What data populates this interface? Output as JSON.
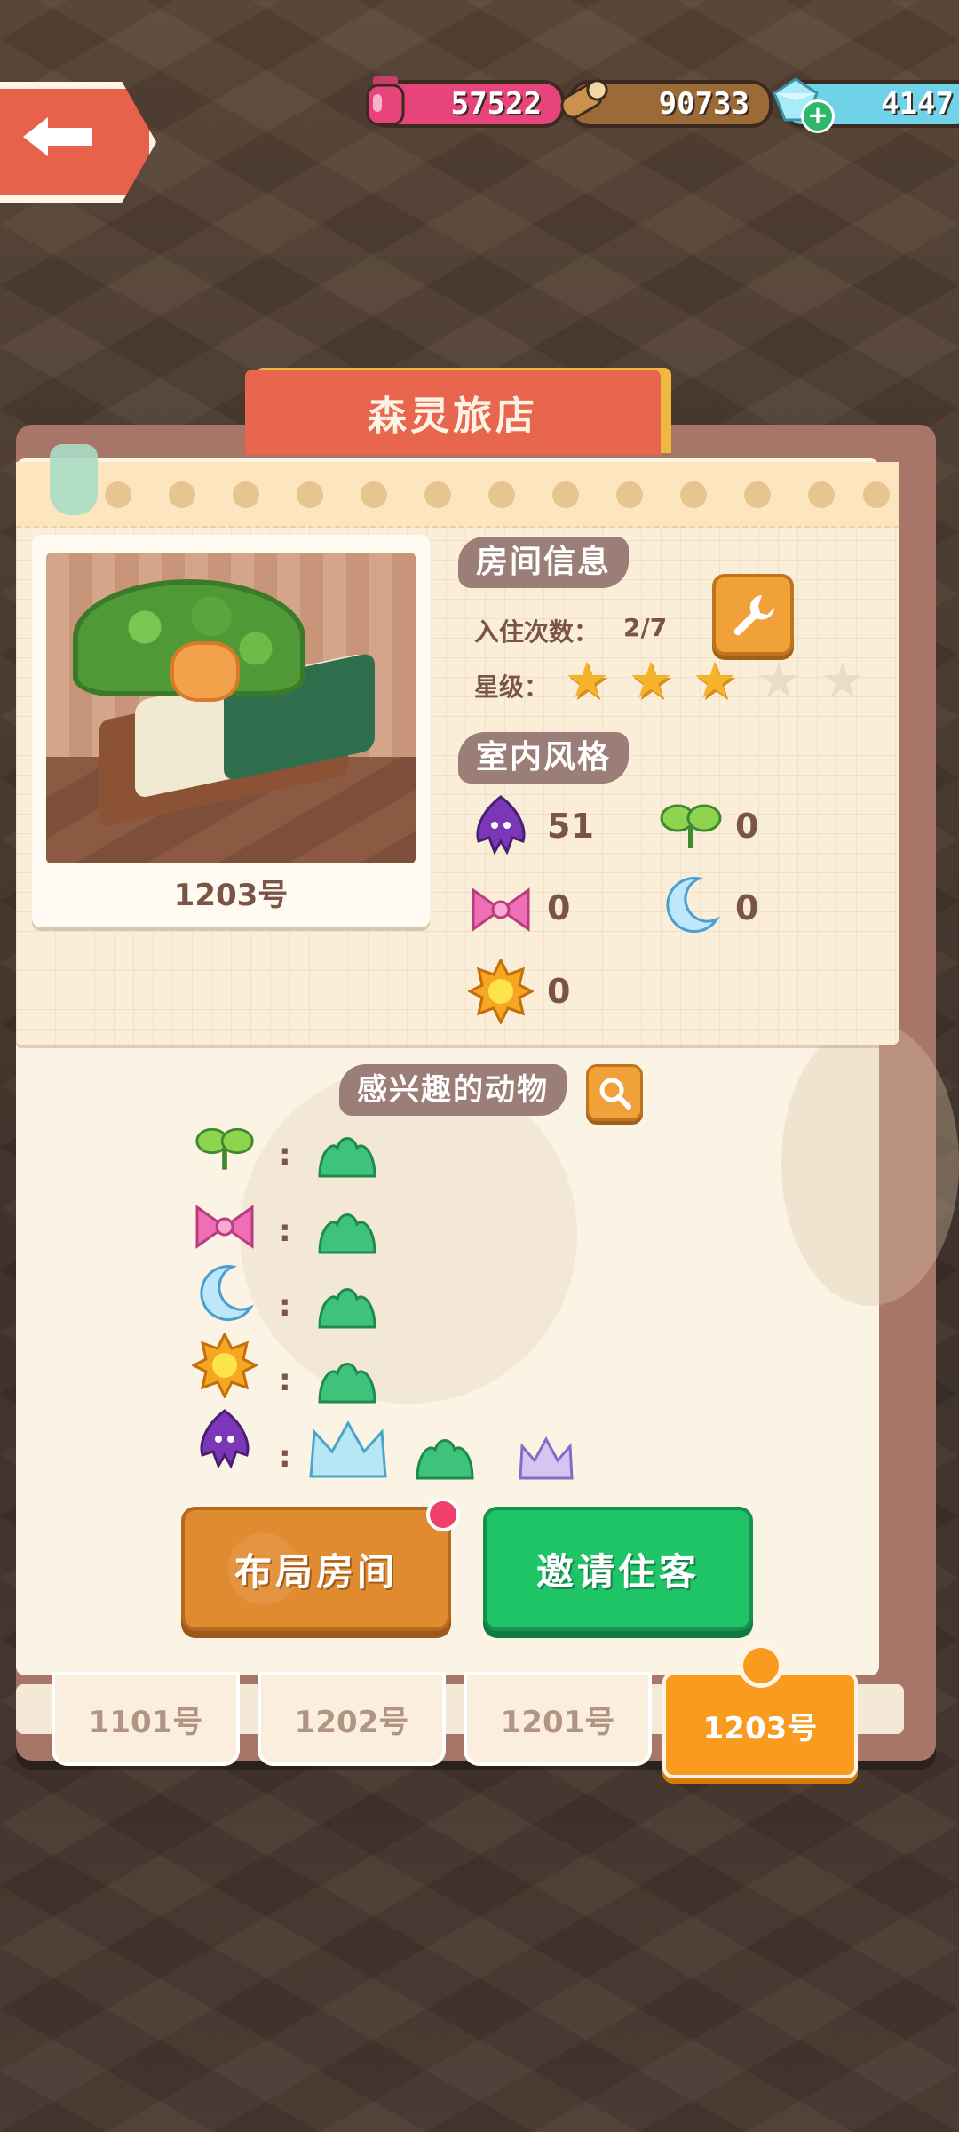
{
  "resources": {
    "ink": "57522",
    "wood": "90733",
    "gems": "4147"
  },
  "title": "森灵旅店",
  "room_card": {
    "room_number": "1203号"
  },
  "room_info": {
    "heading": "房间信息",
    "stay_label": "入住次数：",
    "stay_value": "2/7",
    "star_label": "星级：",
    "stars_filled": 3,
    "stars_total": 5
  },
  "interior_style": {
    "heading": "室内风格",
    "items": [
      {
        "icon": "squid-icon",
        "value": "51"
      },
      {
        "icon": "sprout-icon",
        "value": "0"
      },
      {
        "icon": "bow-icon",
        "value": "0"
      },
      {
        "icon": "moon-icon",
        "value": "0"
      },
      {
        "icon": "sun-icon",
        "value": "0"
      }
    ]
  },
  "interested_animals": {
    "heading": "感兴趣的动物",
    "rows": [
      {
        "icon": "sprout-icon",
        "colon": ":",
        "animals": [
          "green-leaf-icon"
        ]
      },
      {
        "icon": "bow-icon",
        "colon": ":",
        "animals": [
          "green-leaf-icon"
        ]
      },
      {
        "icon": "moon-icon",
        "colon": ":",
        "animals": [
          "green-leaf-icon"
        ]
      },
      {
        "icon": "sun-icon",
        "colon": ":",
        "animals": [
          "green-leaf-icon"
        ]
      },
      {
        "icon": "squid-icon",
        "colon": ":",
        "animals": [
          "blue-crown-icon",
          "green-leaf-icon",
          "purple-crown-icon"
        ]
      }
    ]
  },
  "actions": {
    "layout_room": "布局房间",
    "invite_guest": "邀请住客"
  },
  "room_tabs": [
    {
      "label": "1101号",
      "active": false
    },
    {
      "label": "1202号",
      "active": false
    },
    {
      "label": "1201号",
      "active": false
    },
    {
      "label": "1203号",
      "active": true
    }
  ],
  "colors": {
    "accent_orange": "#f89b1e",
    "invite_green": "#1fc466",
    "title_red": "#e8654e"
  }
}
